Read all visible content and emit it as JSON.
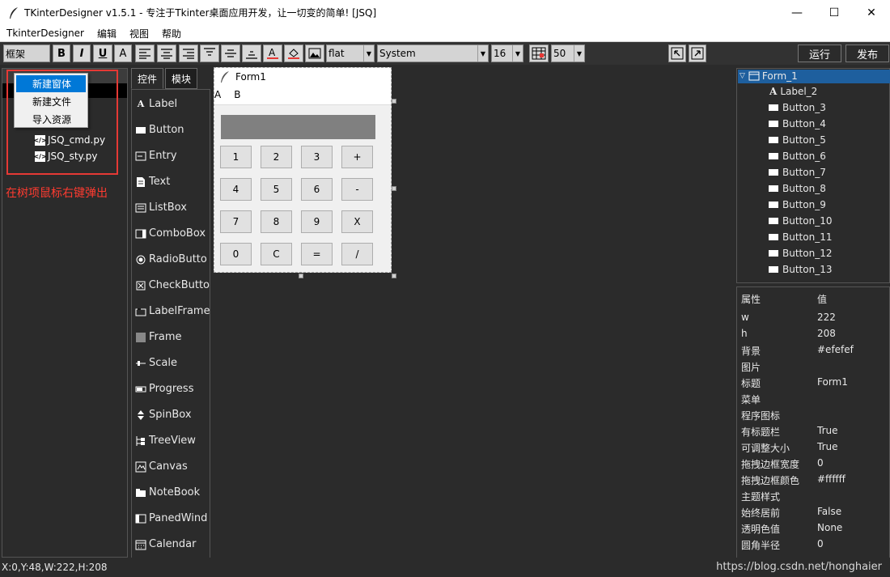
{
  "window": {
    "title": "TKinterDesigner v1.5.1 - 专注于Tkinter桌面应用开发，让一切变的简单!   [JSQ]",
    "minimize": "—",
    "maximize": "☐",
    "close": "✕"
  },
  "menubar": [
    "TkinterDesigner",
    "编辑",
    "视图",
    "帮助"
  ],
  "toolbar": {
    "frame_combo": "框架",
    "bold": "B",
    "italic": "I",
    "underline": "U",
    "font_a": "A",
    "relief_combo": "flat",
    "font_combo": "System",
    "size_combo": "16",
    "grid_size": "50",
    "run_button": "运行",
    "publish_button": "发布"
  },
  "project_tree": {
    "files": [
      "JSQ_cmd.py",
      "JSQ_sty.py"
    ]
  },
  "context_menu": {
    "items": [
      "新建窗体",
      "新建文件",
      "导入资源"
    ]
  },
  "annotation": "在树项鼠标右键弹出",
  "tabs": [
    "控件",
    "模块"
  ],
  "controls": [
    "Label",
    "Button",
    "Entry",
    "Text",
    "ListBox",
    "ComboBox",
    "RadioButto",
    "CheckButto",
    "LabelFrame",
    "Frame",
    "Scale",
    "Progress",
    "SpinBox",
    "TreeView",
    "Canvas",
    "NoteBook",
    "PanedWind",
    "Calendar"
  ],
  "form": {
    "title": "Form1",
    "menu": [
      "A",
      "B"
    ],
    "buttons": [
      "1",
      "2",
      "3",
      "+",
      "4",
      "5",
      "6",
      "-",
      "7",
      "8",
      "9",
      "X",
      "0",
      "C",
      "=",
      "/"
    ]
  },
  "object_tree": {
    "root": "Form_1",
    "children": [
      "Label_2",
      "Button_3",
      "Button_4",
      "Button_5",
      "Button_6",
      "Button_7",
      "Button_8",
      "Button_9",
      "Button_10",
      "Button_11",
      "Button_12",
      "Button_13"
    ]
  },
  "properties": {
    "header_name": "属性",
    "header_value": "值",
    "rows": [
      {
        "k": "w",
        "v": "222"
      },
      {
        "k": "h",
        "v": "208"
      },
      {
        "k": "背景",
        "v": "#efefef"
      },
      {
        "k": "图片",
        "v": ""
      },
      {
        "k": "标题",
        "v": "Form1"
      },
      {
        "k": "菜单",
        "v": ""
      },
      {
        "k": "程序图标",
        "v": ""
      },
      {
        "k": "有标题栏",
        "v": "True"
      },
      {
        "k": "可调整大小",
        "v": "True"
      },
      {
        "k": "拖拽边框宽度",
        "v": "0"
      },
      {
        "k": "拖拽边框颜色",
        "v": "#ffffff"
      },
      {
        "k": "主题样式",
        "v": ""
      },
      {
        "k": "始终居前",
        "v": "False"
      },
      {
        "k": "透明色值",
        "v": "None"
      },
      {
        "k": "圆角半径",
        "v": "0"
      }
    ]
  },
  "status": "X:0,Y:48,W:222,H:208",
  "watermark": "https://blog.csdn.net/honghaier"
}
